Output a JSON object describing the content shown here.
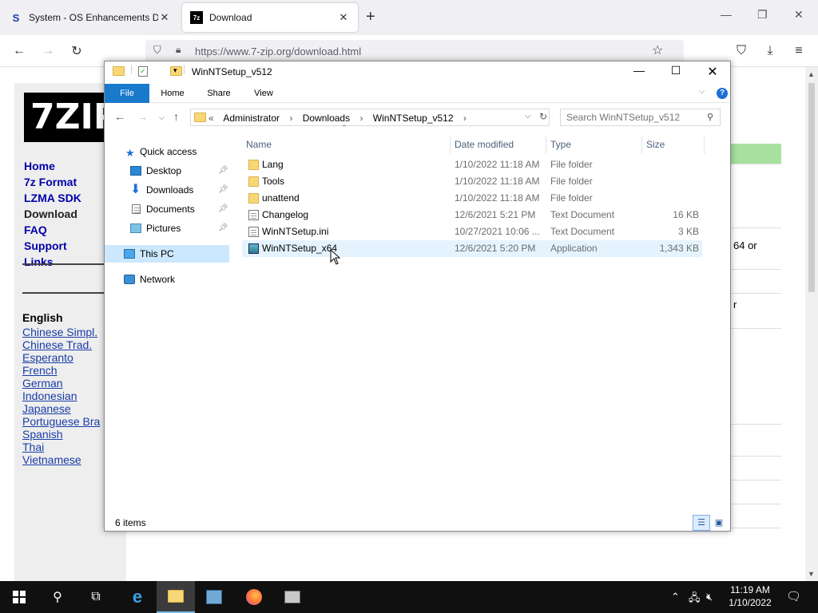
{
  "browser": {
    "tabs": [
      {
        "title": "System - OS Enhancements Do",
        "favicon": "S",
        "active": false
      },
      {
        "title": "Download",
        "favicon": "7z",
        "active": true
      }
    ],
    "new_tab": "+",
    "url": "https://www.7-zip.org/download.html",
    "window_controls": {
      "minimize": "—",
      "maximize": "❐",
      "close": "✕"
    }
  },
  "website": {
    "logo_text": "7ZIP",
    "nav": [
      "Home",
      "7z Format",
      "LZMA SDK",
      "Download",
      "FAQ",
      "Support",
      "Links"
    ],
    "current_nav": "Download",
    "languages_header": "English",
    "languages": [
      "Chinese Simpl.",
      "Chinese Trad.",
      "Esperanto",
      "French",
      "German",
      "Indonesian",
      "Japanese",
      "Portuguese Bra",
      "Spanish",
      "Thai",
      "Vietnamese"
    ],
    "right_snippets": [
      "64 or",
      "r"
    ]
  },
  "explorer": {
    "title": "WinNTSetup_v512",
    "ribbon_tabs": [
      "File",
      "Home",
      "Share",
      "View"
    ],
    "help": "?",
    "breadcrumb_prefix": "«",
    "breadcrumbs": [
      "Administrator",
      "Downloads",
      "WinNTSetup_v512"
    ],
    "search_placeholder": "Search WinNTSetup_v512",
    "nav_pane": {
      "quick_access": "Quick access",
      "pinned": [
        "Desktop",
        "Downloads",
        "Documents",
        "Pictures"
      ],
      "this_pc": "This PC",
      "network": "Network"
    },
    "columns": {
      "name": "Name",
      "date": "Date modified",
      "type": "Type",
      "size": "Size"
    },
    "files": [
      {
        "name": "Lang",
        "date": "1/10/2022 11:18 AM",
        "type": "File folder",
        "size": "",
        "icon": "folder-icon"
      },
      {
        "name": "Tools",
        "date": "1/10/2022 11:18 AM",
        "type": "File folder",
        "size": "",
        "icon": "folder-icon"
      },
      {
        "name": "unattend",
        "date": "1/10/2022 11:18 AM",
        "type": "File folder",
        "size": "",
        "icon": "folder-icon"
      },
      {
        "name": "Changelog",
        "date": "12/6/2021 5:21 PM",
        "type": "Text Document",
        "size": "16 KB",
        "icon": "text-document-icon"
      },
      {
        "name": "WinNTSetup.ini",
        "date": "10/27/2021 10:06 ...",
        "type": "Text Document",
        "size": "3 KB",
        "icon": "text-document-icon"
      },
      {
        "name": "WinNTSetup_x64",
        "date": "12/6/2021 5:20 PM",
        "type": "Application",
        "size": "1,343 KB",
        "icon": "application-icon"
      }
    ],
    "status": "6 items"
  },
  "taskbar": {
    "time": "11:19 AM",
    "date": "1/10/2022"
  },
  "colors": {
    "ribbon_file": "#1979ca",
    "selection": "#cce8ff",
    "hover_row": "#e5f3ff",
    "taskbar": "#101010",
    "link": "#1a3da8"
  }
}
